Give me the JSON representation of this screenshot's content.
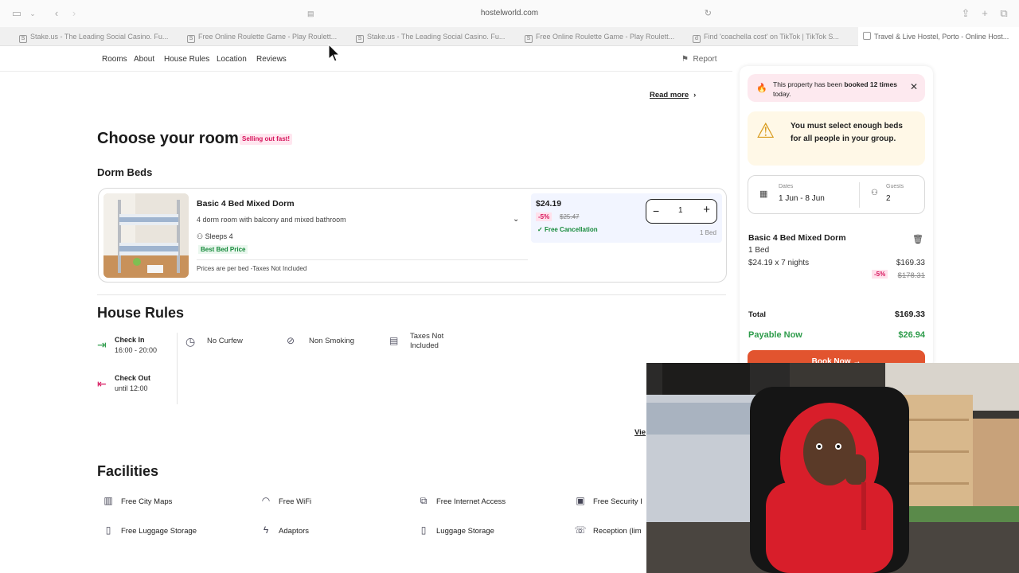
{
  "browser": {
    "url": "hostelworld.com",
    "tabs": [
      {
        "label": "Stake.us - The Leading Social Casino. Fu..."
      },
      {
        "label": "Free Online Roulette Game - Play Roulett..."
      },
      {
        "label": "Stake.us - The Leading Social Casino. Fu..."
      },
      {
        "label": "Free Online Roulette Game - Play Roulett..."
      },
      {
        "label": "Find 'coachella cost' on TikTok | TikTok S..."
      },
      {
        "label": "Travel & Live Hostel, Porto - Online Host..."
      }
    ]
  },
  "nav": {
    "items": [
      "Rooms",
      "About",
      "House Rules",
      "Location",
      "Reviews"
    ],
    "report": "Report"
  },
  "main": {
    "read_more": "Read more",
    "choose_room": "Choose your room",
    "selling_badge": "Selling out fast!",
    "dorm_beds": "Dorm Beds",
    "room": {
      "title": "Basic 4 Bed Mixed Dorm",
      "description": "4 dorm room with balcony and mixed bathroom",
      "sleeps": "Sleeps 4",
      "best_price": "Best Bed Price",
      "note": "Prices are per bed -Taxes Not Included",
      "price": "$24.19",
      "discount": "-5%",
      "old_price": "$25.47",
      "cancellation": "Free Cancellation",
      "quantity": "1",
      "bed_count": "1 Bed"
    },
    "house_rules": {
      "title": "House Rules",
      "check_in_title": "Check In",
      "check_in_time": "16:00 - 20:00",
      "check_out_title": "Check Out",
      "check_out_time": "until 12:00",
      "curfew": "No Curfew",
      "smoking": "Non Smoking",
      "taxes": "Taxes Not Included",
      "view_link": "Vie"
    },
    "facilities": {
      "title": "Facilities",
      "items": [
        "Free City Maps",
        "Free WiFi",
        "Free Internet Access",
        "Free Security I",
        "Free Luggage Storage",
        "Adaptors",
        "Luggage Storage",
        "Reception (lim"
      ]
    }
  },
  "sidebar": {
    "booked_prefix": "This property has been ",
    "booked_bold": "booked 12 times",
    "booked_suffix": " today.",
    "warning": "You must select enough beds for all people in your group.",
    "dates_label": "Dates",
    "dates_value": "1 Jun - 8 Jun",
    "guests_label": "Guests",
    "guests_value": "2",
    "summary_title": "Basic 4 Bed Mixed Dorm",
    "summary_beds": "1 Bed",
    "summary_rate": "$24.19 x 7 nights",
    "summary_subtotal": "$169.33",
    "summary_discount": "-5%",
    "summary_old": "$178.31",
    "total_label": "Total",
    "total_value": "$169.33",
    "payable_label": "Payable Now",
    "payable_value": "$26.94",
    "book_button": "Book Now →"
  },
  "colors": {
    "accent_pink": "#d6135b",
    "green": "#2e9c4b",
    "book_orange": "#e2542f"
  }
}
